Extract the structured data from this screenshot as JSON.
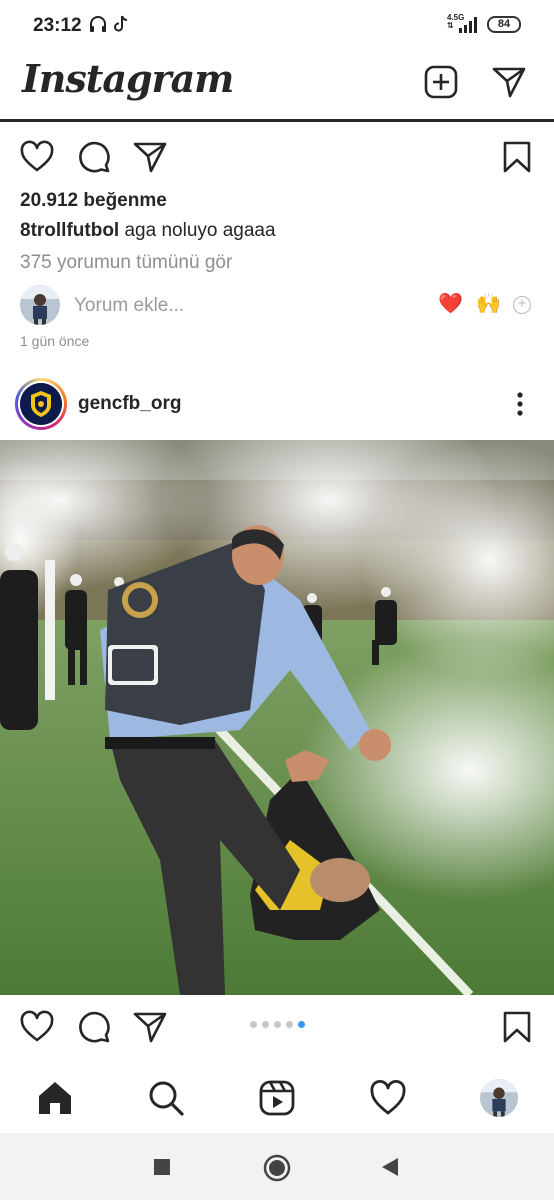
{
  "status_bar": {
    "time": "23:12",
    "network_top": "4.5G",
    "network_bottom": "⇅",
    "battery": "84"
  },
  "header": {
    "logo": "Instagram",
    "icons": [
      "new-post-icon",
      "direct-message-icon"
    ]
  },
  "previous_post": {
    "likes": "20.912 beğenme",
    "caption_user": "8trollfutbol",
    "caption_text": " aga noluyo agaaa",
    "view_comments": "375 yorumun tümünü gör",
    "comment_placeholder": "Yorum ekle...",
    "quick_emojis": [
      "❤️",
      "🙌"
    ],
    "time_ago": "1 gün önce"
  },
  "post": {
    "username": "gencfb_org",
    "carousel": {
      "total": 5,
      "active_index": 5
    }
  },
  "bottom_nav": [
    "home-icon",
    "search-icon",
    "reels-icon",
    "activity-heart-icon",
    "profile-avatar"
  ],
  "system_nav": [
    "recents-square-icon",
    "home-circle-icon",
    "back-triangle-icon"
  ],
  "colors": {
    "text": "#262626",
    "muted": "#8e8e8e",
    "heart_red": "#e0245e",
    "active_dot": "#3897f0"
  }
}
